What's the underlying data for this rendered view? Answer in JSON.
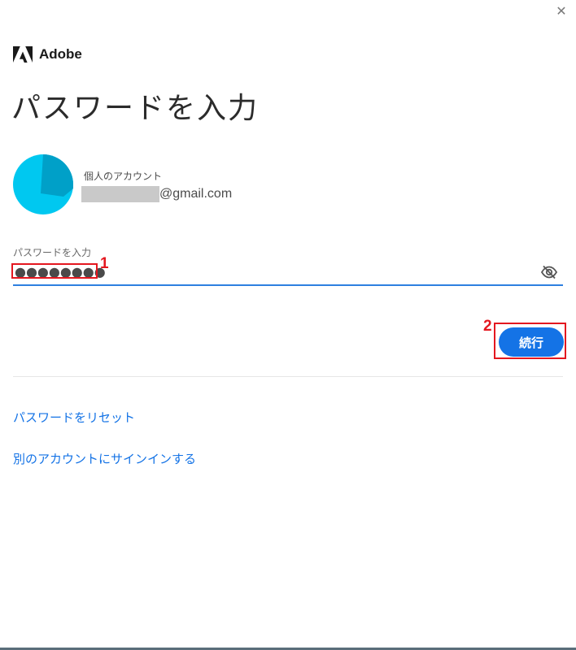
{
  "window": {
    "close_glyph": "✕"
  },
  "brand": {
    "name": "Adobe",
    "logo_icon": "adobe-logo-icon",
    "color": "#1a1a1a"
  },
  "title": "パスワードを入力",
  "account": {
    "type_label": "個人のアカウント",
    "email_domain": "@gmail.com",
    "avatar_color": "#00c8f0"
  },
  "password": {
    "label": "パスワードを入力",
    "value_display": "●●●●●●●●",
    "toggle_icon": "eye-slash-icon"
  },
  "continue_button": {
    "label": "続行",
    "color": "#1473e6"
  },
  "links": {
    "reset_password": "パスワードをリセット",
    "other_account": "別のアカウントにサインインする"
  },
  "annotations": {
    "one": "1",
    "two": "2",
    "color": "#e4171f"
  }
}
